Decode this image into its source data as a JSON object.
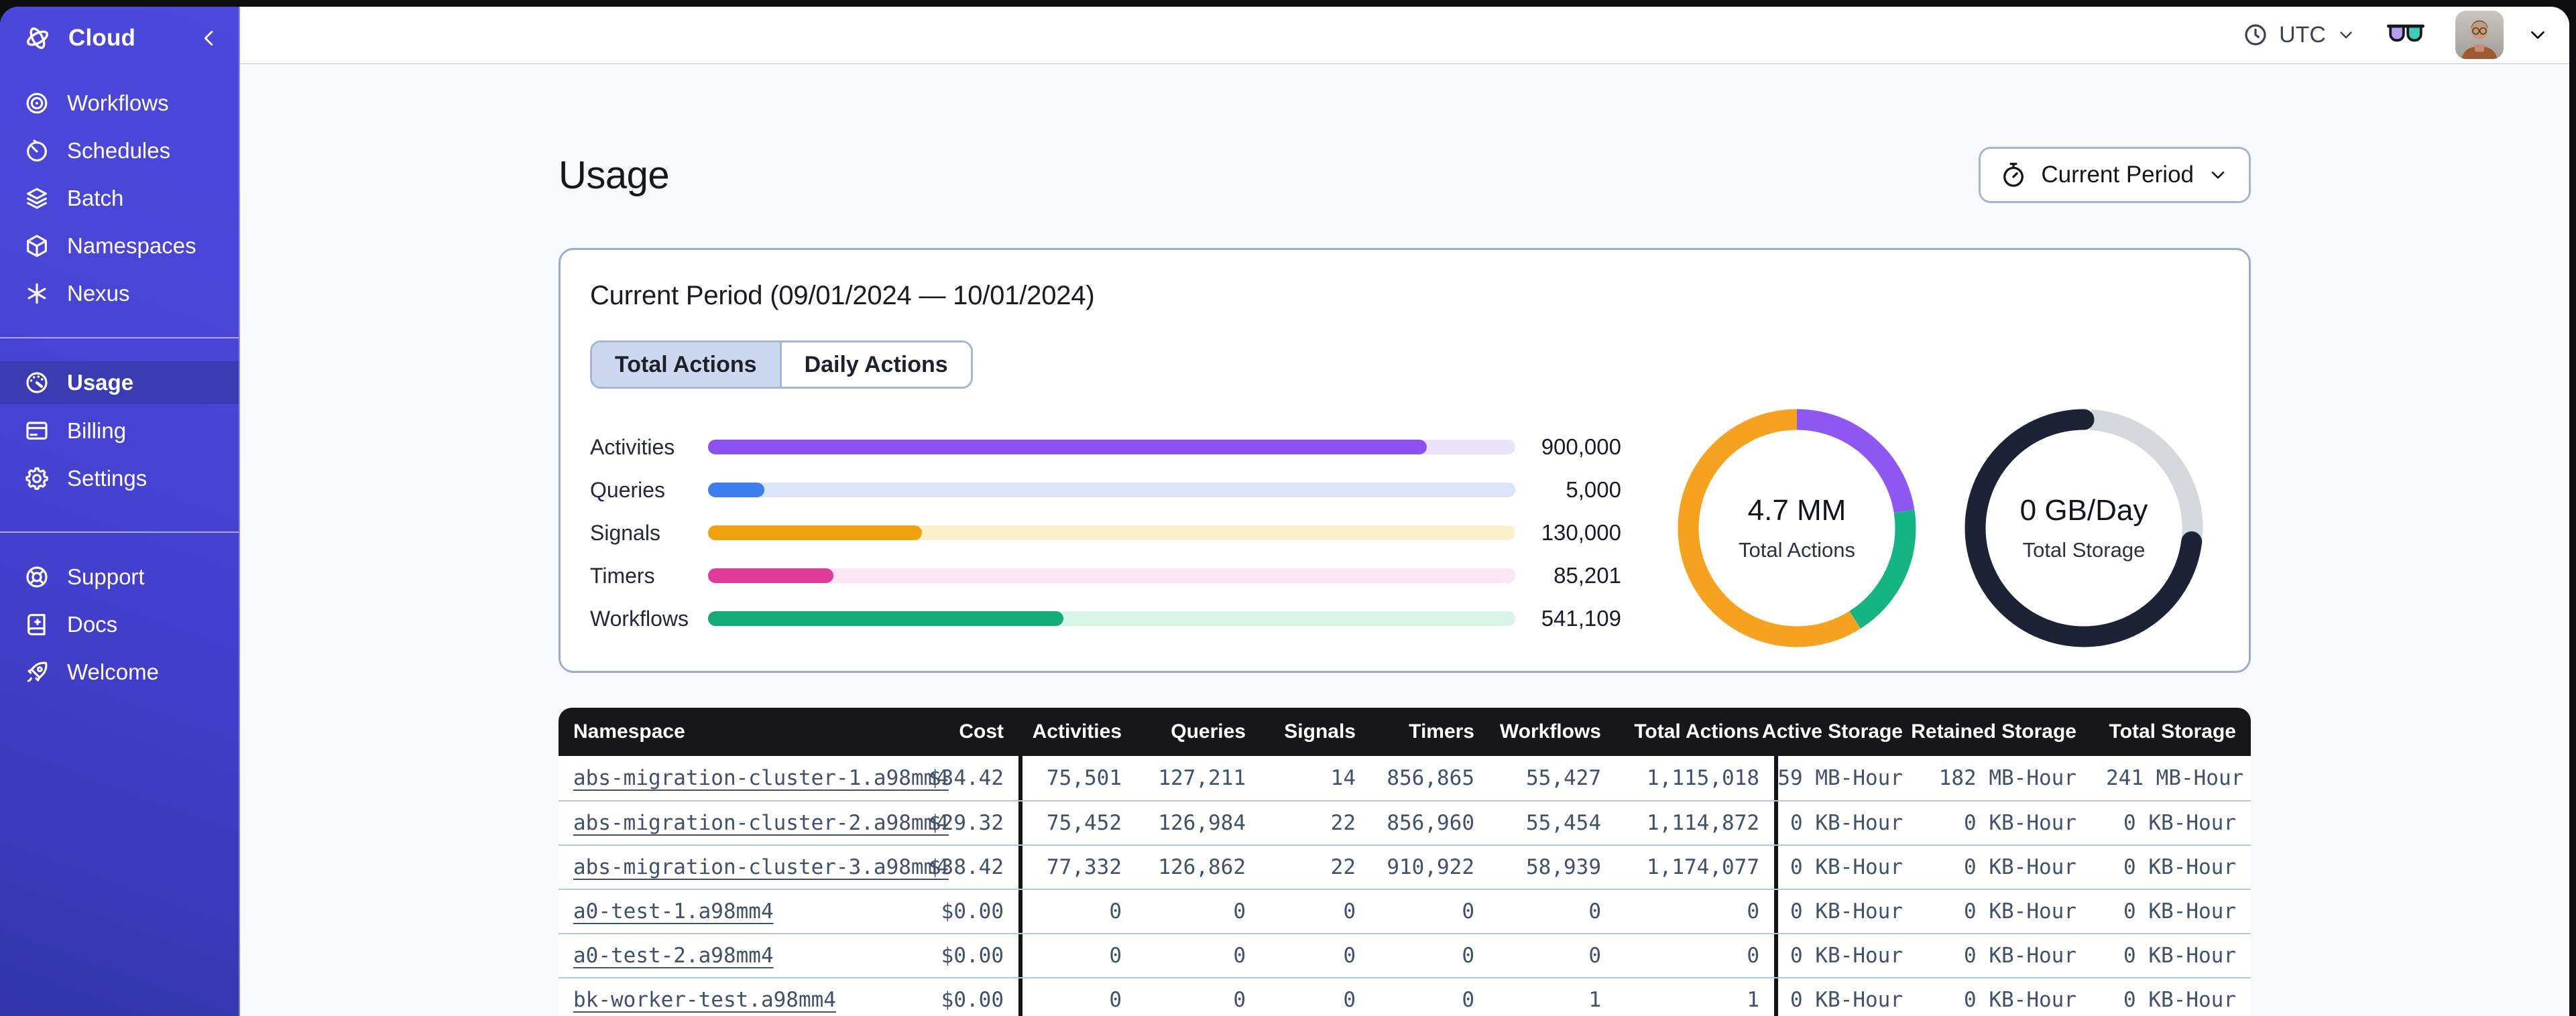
{
  "sidebar": {
    "brand": {
      "label": "Cloud"
    },
    "nav_main": [
      {
        "label": "Workflows",
        "icon": "workflows-icon"
      },
      {
        "label": "Schedules",
        "icon": "schedules-icon"
      },
      {
        "label": "Batch",
        "icon": "batch-icon"
      },
      {
        "label": "Namespaces",
        "icon": "namespaces-icon"
      },
      {
        "label": "Nexus",
        "icon": "nexus-icon"
      }
    ],
    "nav_account": [
      {
        "label": "Usage",
        "icon": "usage-gauge-icon",
        "active": true
      },
      {
        "label": "Billing",
        "icon": "billing-card-icon"
      },
      {
        "label": "Settings",
        "icon": "settings-gear-icon"
      }
    ],
    "nav_footer": [
      {
        "label": "Support",
        "icon": "support-lifebuoy-icon"
      },
      {
        "label": "Docs",
        "icon": "docs-book-icon"
      },
      {
        "label": "Welcome",
        "icon": "welcome-rocket-icon"
      }
    ]
  },
  "topbar": {
    "timezone": "UTC"
  },
  "page": {
    "title": "Usage",
    "period_button_label": "Current Period"
  },
  "usage_card": {
    "title": "Current Period (09/01/2024 — 10/01/2024)",
    "tabs": [
      {
        "label": "Total Actions",
        "active": true
      },
      {
        "label": "Daily Actions",
        "active": false
      }
    ]
  },
  "colors": {
    "sidebar_indigo": "#4643d4",
    "sidebar_active": "#3a3db2",
    "accent_border": "#a9b4d4",
    "table_header_bg": "#17171a",
    "row_divider": "#b9c5e1"
  },
  "chart_data": [
    {
      "type": "bar",
      "orientation": "horizontal",
      "categories": [
        "Activities",
        "Queries",
        "Signals",
        "Timers",
        "Workflows"
      ],
      "values": [
        900000,
        5000,
        130000,
        85201,
        541109
      ],
      "value_labels": [
        "900,000",
        "5,000",
        "130,000",
        "85,201",
        "541,109"
      ],
      "bar_colors": [
        "#8b50f0",
        "#3d7eef",
        "#f0a20c",
        "#e03a9c",
        "#12ac79"
      ],
      "track_colors": [
        "#eae3fb",
        "#d9e5f9",
        "#fbf0c8",
        "#fbe4f6",
        "#d6f5e6"
      ],
      "fill_pct": [
        89,
        7,
        26.5,
        15.5,
        44
      ],
      "grid": false,
      "legend": false
    },
    {
      "type": "donut",
      "center_value": "4.7 MM",
      "center_label": "Total Actions",
      "start": "12 o'clock, clockwise",
      "segments": [
        {
          "name": "activities-purple",
          "color": "#8f57f2",
          "pct": 22.5,
          "offset_pct": 0
        },
        {
          "name": "workflows-green",
          "color": "#14b583",
          "pct": 18.5,
          "offset_pct": 22.5
        },
        {
          "name": "timers-orange",
          "color": "#f6a21e",
          "pct": 59,
          "offset_pct": 41
        }
      ]
    },
    {
      "type": "donut",
      "center_value": "0 GB/Day",
      "center_label": "Total Storage",
      "start": "12 o'clock, clockwise",
      "segments": [
        {
          "name": "remaining-gray",
          "color": "#d5d8dd",
          "pct": 26,
          "offset_pct": 1
        },
        {
          "name": "used-navy",
          "color": "#1b2335",
          "pct": 74,
          "offset_pct": 27,
          "rounded": true
        }
      ]
    }
  ],
  "table": {
    "headers": [
      "Namespace",
      "Cost",
      "Activities",
      "Queries",
      "Signals",
      "Timers",
      "Workflows",
      "Total Actions",
      "Active Storage",
      "Retained Storage",
      "Total Storage"
    ],
    "rows": [
      [
        "abs-migration-cluster-1.a98mm4",
        "$34.42",
        "75,501",
        "127,211",
        "14",
        "856,865",
        "55,427",
        "1,115,018",
        "59 MB-Hour",
        "182 MB-Hour",
        "241 MB-Hour"
      ],
      [
        "abs-migration-cluster-2.a98mm4",
        "$29.32",
        "75,452",
        "126,984",
        "22",
        "856,960",
        "55,454",
        "1,114,872",
        "0 KB-Hour",
        "0 KB-Hour",
        "0 KB-Hour"
      ],
      [
        "abs-migration-cluster-3.a98mm4",
        "$38.42",
        "77,332",
        "126,862",
        "22",
        "910,922",
        "58,939",
        "1,174,077",
        "0 KB-Hour",
        "0 KB-Hour",
        "0 KB-Hour"
      ],
      [
        "a0-test-1.a98mm4",
        "$0.00",
        "0",
        "0",
        "0",
        "0",
        "0",
        "0",
        "0 KB-Hour",
        "0 KB-Hour",
        "0 KB-Hour"
      ],
      [
        "a0-test-2.a98mm4",
        "$0.00",
        "0",
        "0",
        "0",
        "0",
        "0",
        "0",
        "0 KB-Hour",
        "0 KB-Hour",
        "0 KB-Hour"
      ],
      [
        "bk-worker-test.a98mm4",
        "$0.00",
        "0",
        "0",
        "0",
        "0",
        "1",
        "1",
        "0 KB-Hour",
        "0 KB-Hour",
        "0 KB-Hour"
      ]
    ]
  }
}
